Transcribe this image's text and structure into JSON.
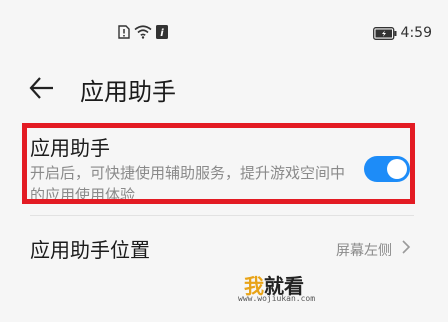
{
  "status_bar": {
    "time": "4:59",
    "icons": [
      "sim-alert-icon",
      "wifi-icon",
      "data-icon",
      "battery-icon"
    ]
  },
  "header": {
    "title": "应用助手"
  },
  "assistant": {
    "title": "应用助手",
    "description": "开启后，可快捷使用辅助服务，提升游戏空间中的应用使用体验",
    "enabled": true
  },
  "position_setting": {
    "title": "应用助手位置",
    "value": "屏幕左侧"
  },
  "watermark": {
    "wo": "我",
    "rest": "就看",
    "url": "www.wojiukan.com"
  },
  "colors": {
    "accent": "#1d8cf8",
    "highlight": "#e31b23",
    "background": "#f6f6f6"
  }
}
